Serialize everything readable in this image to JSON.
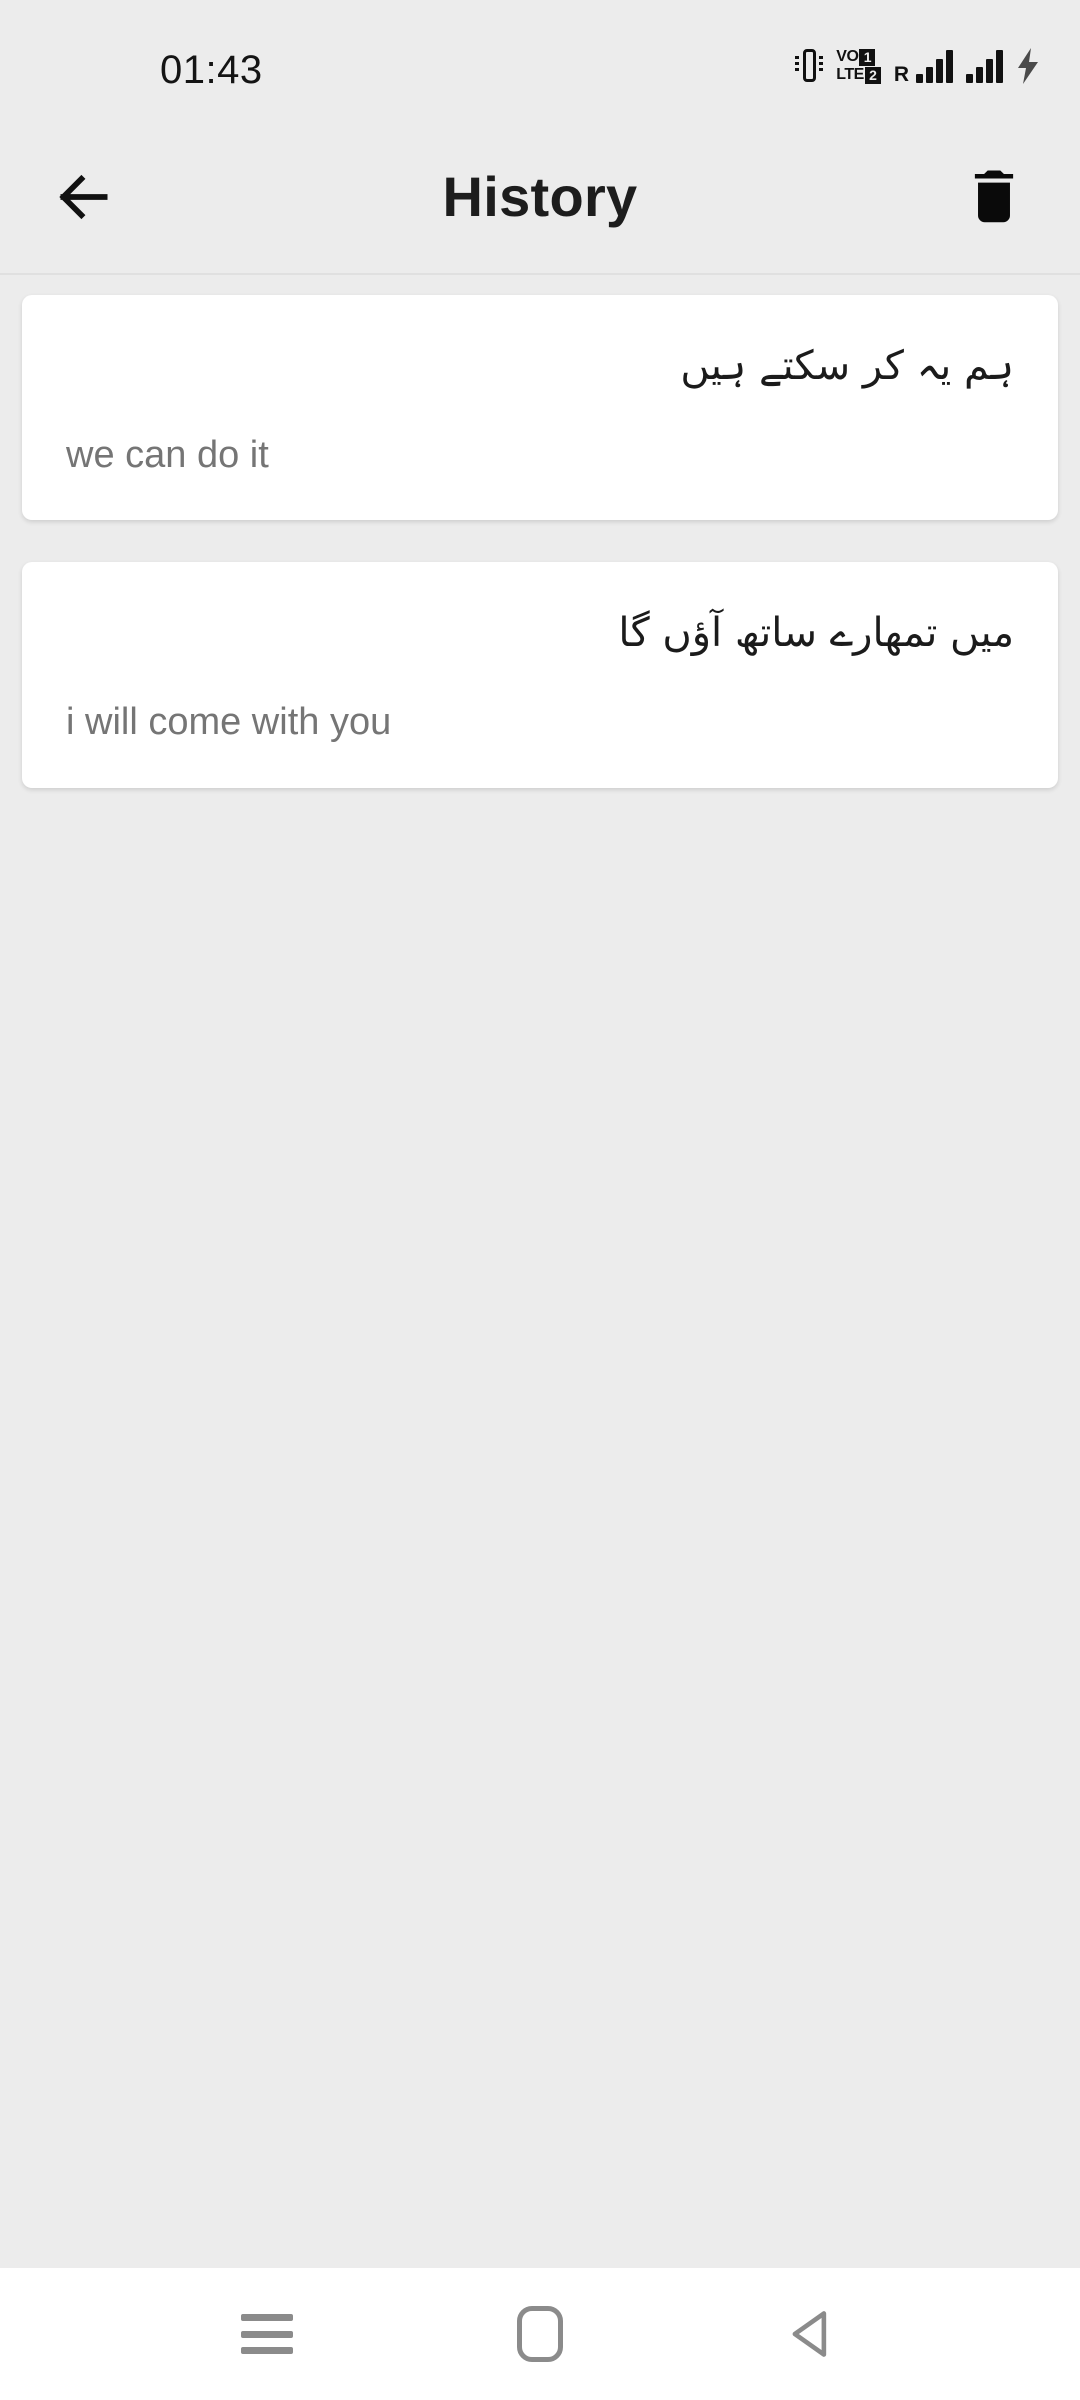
{
  "status_bar": {
    "time": "01:43",
    "icons": [
      {
        "name": "vibrate-icon",
        "label": "vibrate"
      },
      {
        "name": "volte-dual-sim-icon",
        "vo": "VO",
        "lte": "LTE",
        "sim1": "1",
        "sim2": "2"
      },
      {
        "name": "roaming-icon",
        "label": "R"
      },
      {
        "name": "signal-bars-sim1-icon",
        "bars": 4
      },
      {
        "name": "signal-bars-sim2-icon",
        "bars": 4
      },
      {
        "name": "battery-charging-icon",
        "label": "charging"
      }
    ]
  },
  "app_bar": {
    "back_icon": "arrow-left-icon",
    "title": "History",
    "delete_icon": "trash-icon"
  },
  "history": {
    "items": [
      {
        "source_text": "ہم یہ کر سکتے ہیں",
        "target_text": "we can do it"
      },
      {
        "source_text": "میں تمھارے ساتھ آؤں گا",
        "target_text": "i will come with you"
      }
    ]
  },
  "nav_bar": {
    "recents_icon": "menu-icon",
    "home_icon": "home-square-icon",
    "back_icon": "triangle-back-icon"
  },
  "colors": {
    "background": "#ececec",
    "card": "#ffffff",
    "primary_text": "#1b1b1b",
    "secondary_text": "#757575",
    "nav_icon": "#8b8b8b"
  }
}
